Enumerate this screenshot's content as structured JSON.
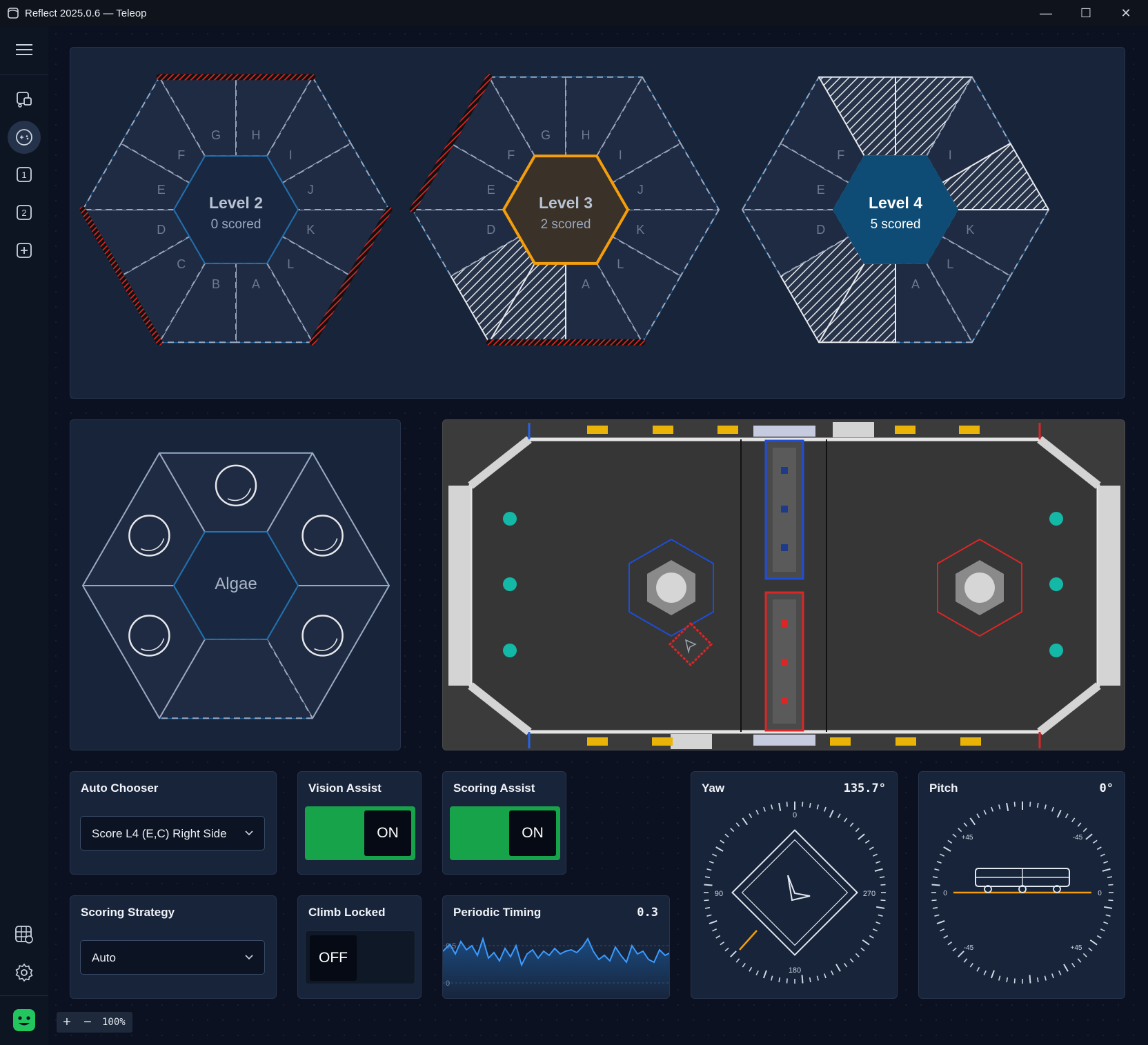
{
  "window": {
    "title": "Reflect 2025.0.6 — Teleop",
    "minimize": "—",
    "maximize": "☐",
    "close": "✕"
  },
  "sidebar": {
    "items": [
      {
        "name": "menu",
        "icon": "hamburger-icon"
      },
      {
        "name": "robot",
        "icon": "robot-icon"
      },
      {
        "name": "teleop",
        "icon": "gamepad-icon",
        "active": true
      },
      {
        "name": "tab-1",
        "label": "1"
      },
      {
        "name": "tab-2",
        "label": "2"
      },
      {
        "name": "add-tab",
        "icon": "plus-icon"
      },
      {
        "name": "field-map",
        "icon": "globe-grid-icon"
      },
      {
        "name": "settings",
        "icon": "gear-icon"
      },
      {
        "name": "app-logo",
        "icon": "logo-icon"
      }
    ]
  },
  "reef": {
    "branch_letters": [
      "A",
      "B",
      "C",
      "D",
      "E",
      "F",
      "G",
      "H",
      "I",
      "J",
      "K",
      "L"
    ],
    "levels": [
      {
        "title": "Level 2",
        "status": "0 scored"
      },
      {
        "title": "Level 3",
        "status": "2 scored"
      },
      {
        "title": "Level 4",
        "status": "5 scored"
      }
    ]
  },
  "algae": {
    "title": "Algae"
  },
  "auto_chooser": {
    "title": "Auto Chooser",
    "value": "Score L4 (E,C) Right Side"
  },
  "vision_assist": {
    "title": "Vision Assist",
    "state": "ON"
  },
  "scoring_assist": {
    "title": "Scoring Assist",
    "state": "ON"
  },
  "scoring_strategy": {
    "title": "Scoring Strategy",
    "value": "Auto"
  },
  "climb_locked": {
    "title": "Climb Locked",
    "state": "OFF"
  },
  "periodic_timing": {
    "title": "Periodic Timing",
    "value": "0.3",
    "axis": [
      "0.5",
      "0"
    ]
  },
  "yaw": {
    "title": "Yaw",
    "value": "135.7°",
    "ticks": {
      "top": "0",
      "left": "90",
      "right": "270",
      "bottom": "180"
    }
  },
  "pitch": {
    "title": "Pitch",
    "value": "0°",
    "ticks": {
      "tl": "+45",
      "tr": "-45",
      "left": "0",
      "right": "0",
      "bl": "-45",
      "br": "+45"
    }
  },
  "zoom": {
    "plus": "+",
    "minus": "−",
    "level": "100%"
  },
  "colors": {
    "accent_green": "#16a34a",
    "orange": "#f59e0b",
    "blue": "#0f4c75",
    "red": "#dc2626",
    "panel": "#18243a"
  }
}
